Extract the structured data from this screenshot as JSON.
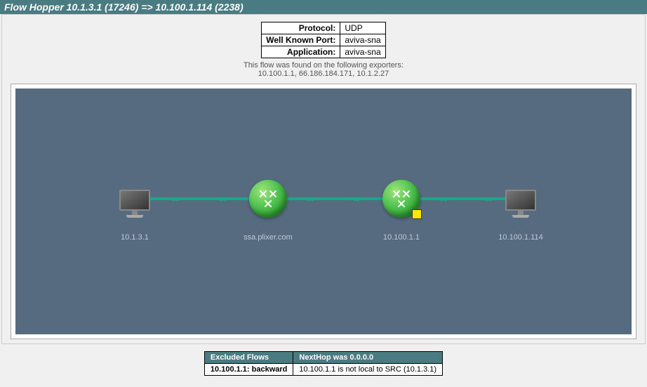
{
  "title": "Flow Hopper 10.1.3.1 (17246) => 10.100.1.114 (2238)",
  "info": {
    "protocol_label": "Protocol:",
    "protocol_value": "UDP",
    "wellknown_label": "Well Known Port:",
    "wellknown_value": "aviva-sna",
    "application_label": "Application:",
    "application_value": "aviva-sna"
  },
  "exporters_msg": "This flow was found on the following exporters:",
  "exporters_list": "10.100.1.1, 66.186.184.171, 10.1.2.27",
  "nodes": [
    {
      "label": "10.1.3.1"
    },
    {
      "label": "ssa.plixer.com"
    },
    {
      "label": "10.100.1.1"
    },
    {
      "label": "10.100.1.114"
    }
  ],
  "footer": {
    "h1": "Excluded Flows",
    "h2": "NextHop was 0.0.0.0",
    "cell1": "10.100.1.1: backward",
    "cell2": "10.100.1.1 is not local to SRC (10.1.3.1)"
  }
}
